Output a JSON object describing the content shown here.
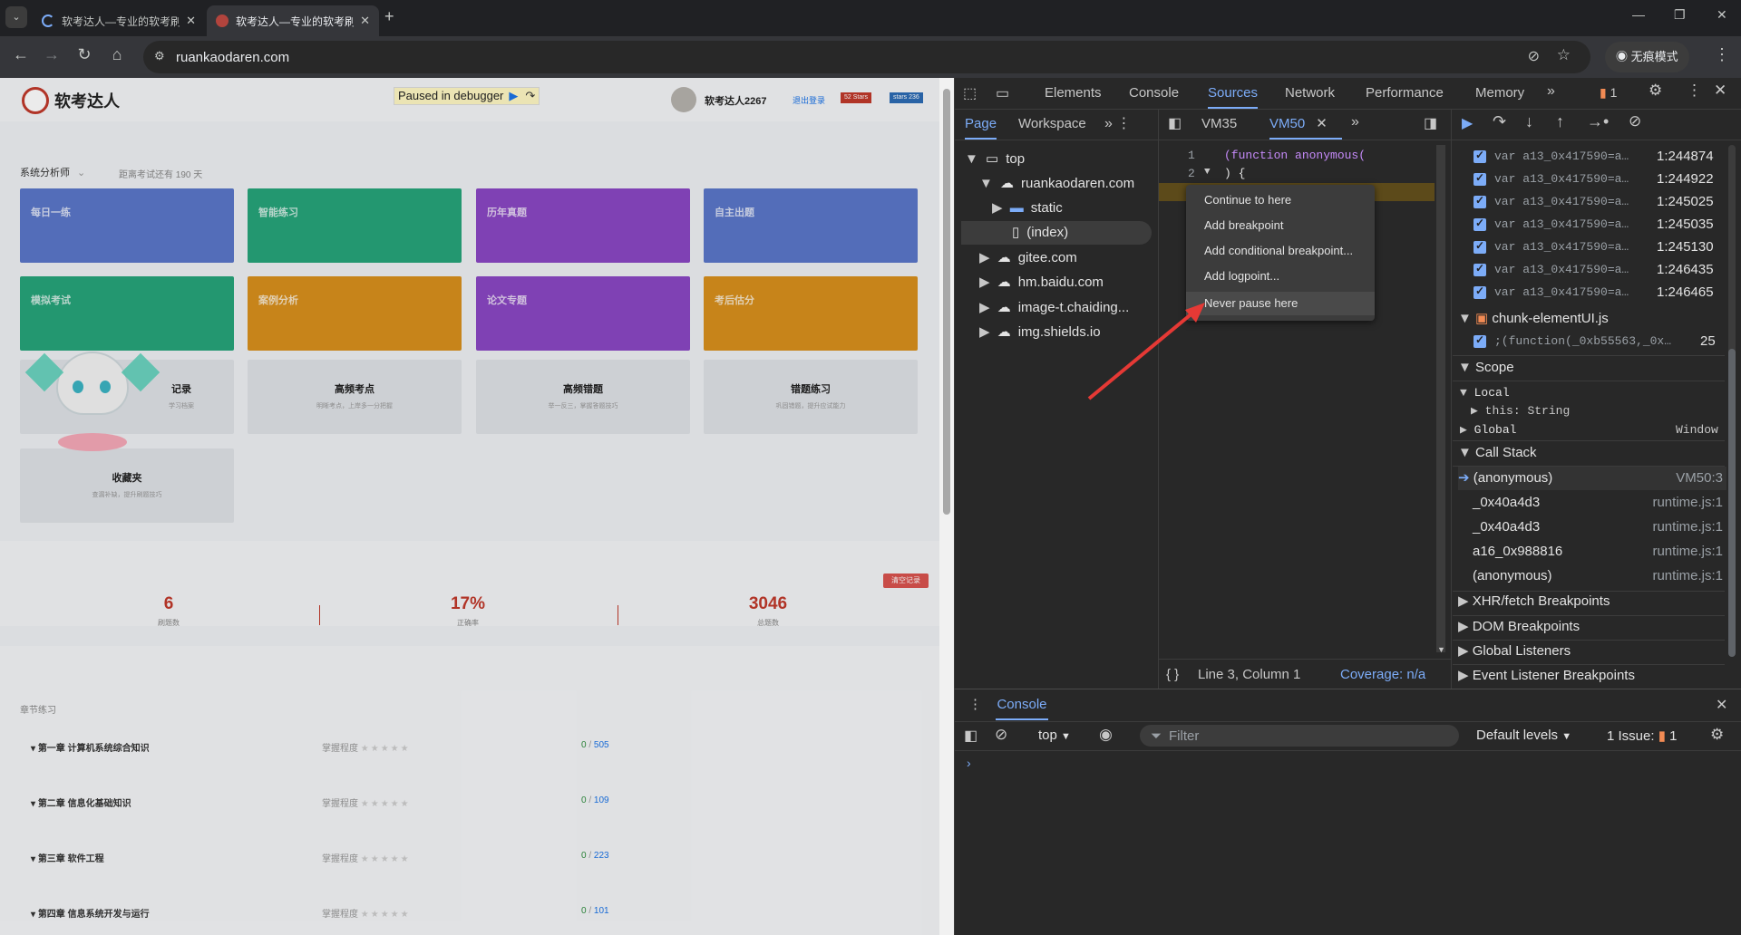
{
  "browser": {
    "tabs": [
      {
        "title": "软考达人—专业的软考刷题题库"
      },
      {
        "title": "软考达人—专业的软考刷题题库"
      }
    ],
    "url": "ruankaodaren.com",
    "incognito_label": "无痕模式"
  },
  "site": {
    "logo_text": "软考达人",
    "debugger_banner": "Paused in debugger",
    "username": "软考达人2267",
    "logout": "退出登录",
    "badge1": "52 Stars",
    "badge2": "stars 236",
    "exam_select": "系统分析师",
    "countdown": "距离考试还有 190 天",
    "cards": [
      {
        "title": "每日一练"
      },
      {
        "title": "智能练习"
      },
      {
        "title": "历年真题"
      },
      {
        "title": "自主出题"
      },
      {
        "title": "模拟考试"
      },
      {
        "title": "案例分析"
      },
      {
        "title": "论文专题"
      },
      {
        "title": "考后估分"
      }
    ],
    "grey_cards": [
      {
        "title": "记录",
        "sub": "学习档案"
      },
      {
        "title": "高频考点",
        "sub": "明晰考点，上岸多一分把握"
      },
      {
        "title": "高频错题",
        "sub": "举一反三，掌握答题技巧"
      },
      {
        "title": "错题练习",
        "sub": "巩固错题，提升应试能力"
      },
      {
        "title": "收藏夹",
        "sub": "查漏补缺，提升刷题技巧"
      }
    ],
    "clear_btn": "清空记录",
    "stats": [
      {
        "value": "6",
        "label": "刷题数"
      },
      {
        "value": "17%",
        "label": "正确率"
      },
      {
        "value": "3046",
        "label": "总题数"
      }
    ],
    "chapters_title": "章节练习",
    "chapters": [
      {
        "name": "第一章 计算机系统综合知识",
        "mastery": "掌握程度",
        "done": "0",
        "total": "505"
      },
      {
        "name": "第二章 信息化基础知识",
        "mastery": "掌握程度",
        "done": "0",
        "total": "109"
      },
      {
        "name": "第三章 软件工程",
        "mastery": "掌握程度",
        "done": "0",
        "total": "223"
      },
      {
        "name": "第四章 信息系统开发与运行",
        "mastery": "掌握程度",
        "done": "0",
        "total": "101"
      }
    ]
  },
  "devtools": {
    "main_tabs": [
      "Elements",
      "Console",
      "Sources",
      "Network",
      "Performance",
      "Memory"
    ],
    "issues_count": "1",
    "nav_tabs": [
      "Page",
      "Workspace"
    ],
    "file_tree": [
      {
        "label": "top"
      },
      {
        "label": "ruankaodaren.com"
      },
      {
        "label": "static"
      },
      {
        "label": "(index)"
      },
      {
        "label": "gitee.com"
      },
      {
        "label": "hm.baidu.com"
      },
      {
        "label": "image-t.chaiding..."
      },
      {
        "label": "img.shields.io"
      }
    ],
    "editor_tabs": [
      "VM35",
      "VM50"
    ],
    "code_lines": [
      {
        "num": "1",
        "text": "(function anonymous("
      },
      {
        "num": "2",
        "text": ") {"
      }
    ],
    "context_menu": [
      "Continue to here",
      "Add breakpoint",
      "Add conditional breakpoint...",
      "Add logpoint...",
      "Never pause here"
    ],
    "status_position": "Line 3, Column 1",
    "coverage": "Coverage: n/a",
    "breakpoints": [
      {
        "code": "var a13_0x417590=a…",
        "loc": "1:244874"
      },
      {
        "code": "var a13_0x417590=a…",
        "loc": "1:244922"
      },
      {
        "code": "var a13_0x417590=a…",
        "loc": "1:245025"
      },
      {
        "code": "var a13_0x417590=a…",
        "loc": "1:245035"
      },
      {
        "code": "var a13_0x417590=a…",
        "loc": "1:245130"
      },
      {
        "code": "var a13_0x417590=a…",
        "loc": "1:246435"
      },
      {
        "code": "var a13_0x417590=a…",
        "loc": "1:246465"
      }
    ],
    "bp_file": "chunk-elementUI.js",
    "bp_file_line": {
      "code": ";(function(_0xb55563,_0x…",
      "loc": "25"
    },
    "scope_title": "Scope",
    "scope_local": "Local",
    "scope_this": "this: String",
    "scope_global": "Global",
    "scope_global_val": "Window",
    "call_stack_title": "Call Stack",
    "call_stack": [
      {
        "fn": "(anonymous)",
        "loc": "VM50:3"
      },
      {
        "fn": "_0x40a4d3",
        "loc": "runtime.js:1"
      },
      {
        "fn": "_0x40a4d3",
        "loc": "runtime.js:1"
      },
      {
        "fn": "a16_0x988816",
        "loc": "runtime.js:1"
      },
      {
        "fn": "(anonymous)",
        "loc": "runtime.js:1"
      }
    ],
    "more_sections": [
      "XHR/fetch Breakpoints",
      "DOM Breakpoints",
      "Global Listeners",
      "Event Listener Breakpoints"
    ],
    "console_tab": "Console",
    "console_context": "top",
    "filter_placeholder": "Filter",
    "default_levels": "Default levels",
    "issue_text": "1 Issue:",
    "issue_count": "1"
  },
  "colors": {
    "accent": "#7cacf8",
    "red_arrow": "#e53935",
    "paused_line": "#5c4a1a"
  }
}
